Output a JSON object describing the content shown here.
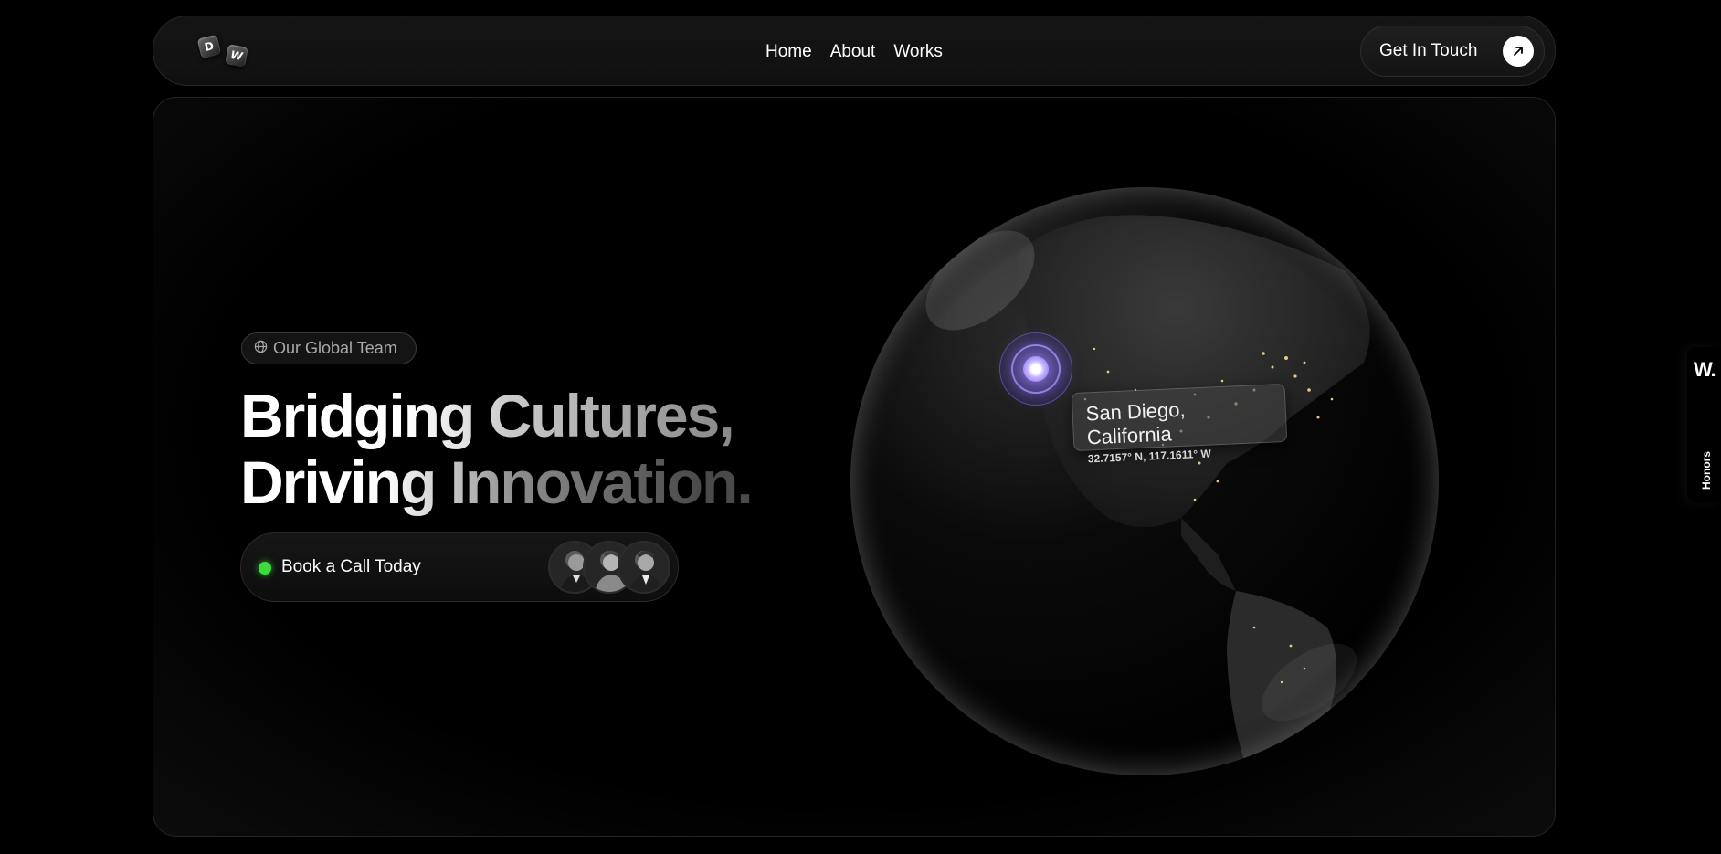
{
  "nav": {
    "logo": {
      "letter_1": "D",
      "letter_2": "W"
    },
    "links": [
      {
        "label": "Home"
      },
      {
        "label": "About"
      },
      {
        "label": "Works"
      }
    ],
    "cta_label": "Get In Touch"
  },
  "hero": {
    "badge_icon": "globe-icon",
    "badge_text": "Our Global Team",
    "headline_line_1": "Bridging Cultures,",
    "headline_line_2": "Driving Innovation.",
    "booking_label": "Book a Call Today",
    "status_color": "#3bdc3b",
    "avatars_count": 3
  },
  "globe": {
    "marker_color": "#7c5cf0",
    "location_city": "San Diego, California",
    "location_coordinates": "32.7157° N, 117.1611° W"
  },
  "side_tab": {
    "logo": "W.",
    "label": "Honors"
  }
}
